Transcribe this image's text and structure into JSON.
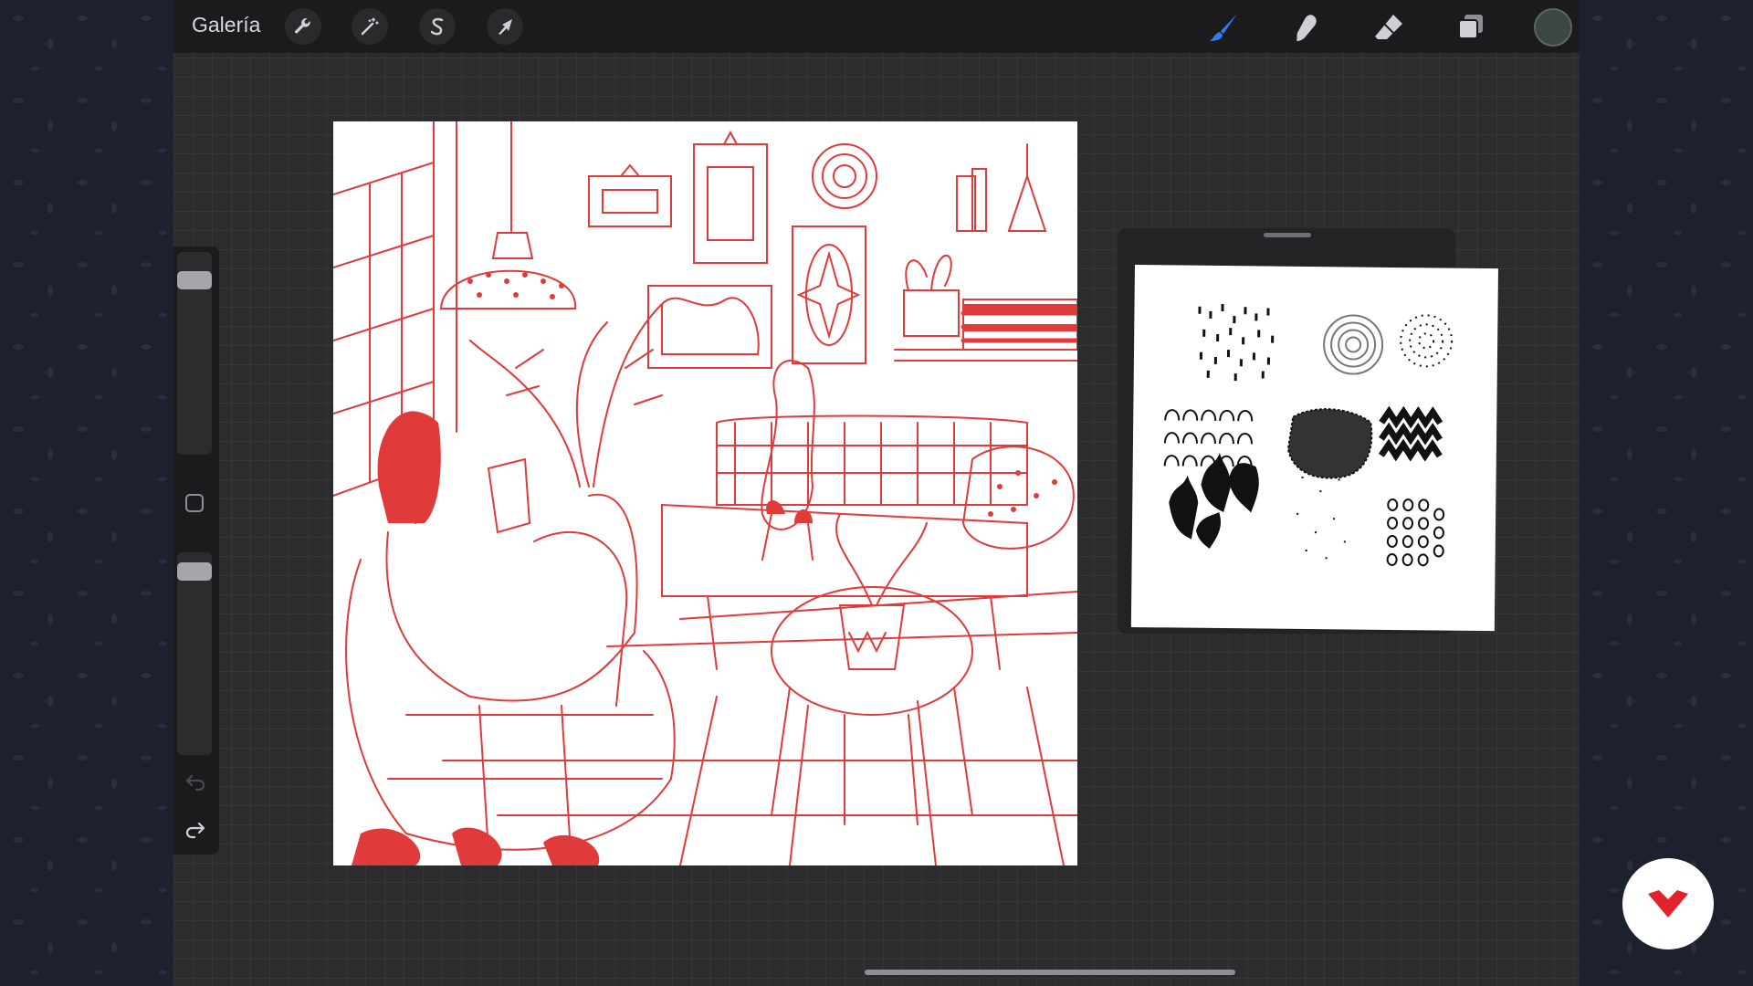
{
  "topbar": {
    "gallery_label": "Galería",
    "left_tools": [
      {
        "icon": "wrench-icon",
        "name": "actions-button"
      },
      {
        "icon": "magic-wand-icon",
        "name": "adjustments-button"
      },
      {
        "icon": "selection-s-icon",
        "name": "selection-button"
      },
      {
        "icon": "arrow-cursor-icon",
        "name": "transform-button"
      }
    ],
    "right_tools": [
      {
        "icon": "brush-icon",
        "name": "brush-tool",
        "active": true
      },
      {
        "icon": "smudge-icon",
        "name": "smudge-tool"
      },
      {
        "icon": "eraser-icon",
        "name": "eraser-tool"
      },
      {
        "icon": "layers-icon",
        "name": "layers-button"
      }
    ],
    "current_color": "#3c4744"
  },
  "sidebar": {
    "brush_size_level": 0.9,
    "opacity_level": 0.95,
    "icons": [
      "modify-square-icon",
      "undo-icon",
      "redo-icon"
    ]
  },
  "colors": {
    "accent_active": "#2f7dee",
    "sketch_red": "#e03a3a",
    "brand_red": "#e4222b"
  }
}
